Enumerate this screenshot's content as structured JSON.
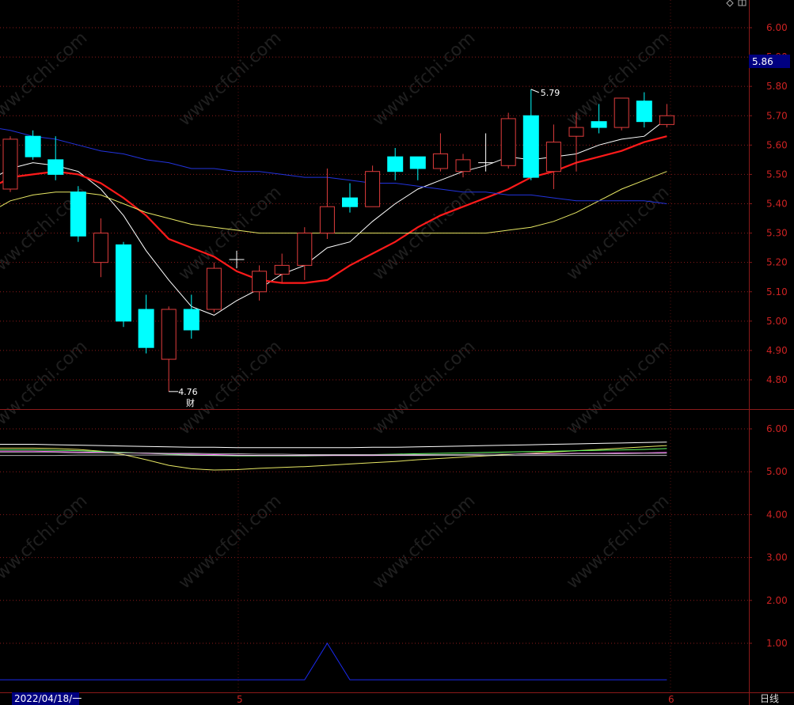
{
  "watermark": "www.cfchi.com",
  "timeframe_label": "日线",
  "date_label": "2022/04/18/一",
  "month_labels": [
    "5",
    "6"
  ],
  "finance_marker": "财",
  "current_price_tag": "5.86",
  "colors": {
    "background": "#000000",
    "frame": "#8b1a1a",
    "grid": "#8b1a1a",
    "axis_text": "#cc2222",
    "up": "#e03c3c",
    "down": "#00ffff",
    "ma5": "#ffffff",
    "ma10": "#ff1a1a",
    "ma20": "#e8e864",
    "ma60": "#2233dd",
    "current_tag_bg": "#000080",
    "volume_line": "#1a2aee"
  },
  "chart_data": [
    {
      "type": "candlestick",
      "panel": "main",
      "y_ticks": [
        "6.00",
        "5.90",
        "5.80",
        "5.70",
        "5.60",
        "5.50",
        "5.40",
        "5.30",
        "5.20",
        "5.10",
        "5.00",
        "4.90",
        "4.80"
      ],
      "ylim": [
        4.72,
        6.03
      ],
      "grid": true,
      "annotations": [
        {
          "text": "5.79",
          "value": 5.79,
          "kind": "high"
        },
        {
          "text": "4.76",
          "value": 4.76,
          "kind": "low"
        }
      ],
      "candles": [
        {
          "open": 5.45,
          "close": 5.62,
          "high": 5.63,
          "low": 5.44
        },
        {
          "open": 5.63,
          "close": 5.56,
          "high": 5.65,
          "low": 5.55
        },
        {
          "open": 5.55,
          "close": 5.5,
          "high": 5.63,
          "low": 5.48
        },
        {
          "open": 5.44,
          "close": 5.29,
          "high": 5.46,
          "low": 5.27
        },
        {
          "open": 5.2,
          "close": 5.3,
          "high": 5.35,
          "low": 5.15
        },
        {
          "open": 5.26,
          "close": 5.0,
          "high": 5.27,
          "low": 4.98
        },
        {
          "open": 5.04,
          "close": 4.91,
          "high": 5.09,
          "low": 4.89
        },
        {
          "open": 4.87,
          "close": 5.04,
          "high": 5.05,
          "low": 4.76
        },
        {
          "open": 5.04,
          "close": 4.97,
          "high": 5.09,
          "low": 4.94
        },
        {
          "open": 5.04,
          "close": 5.18,
          "high": 5.2,
          "low": 5.03
        },
        {
          "open": 5.21,
          "close": 5.21,
          "high": 5.24,
          "low": 5.18
        },
        {
          "open": 5.1,
          "close": 5.17,
          "high": 5.19,
          "low": 5.07
        },
        {
          "open": 5.16,
          "close": 5.19,
          "high": 5.23,
          "low": 5.13
        },
        {
          "open": 5.19,
          "close": 5.3,
          "high": 5.32,
          "low": 5.14
        },
        {
          "open": 5.3,
          "close": 5.39,
          "high": 5.52,
          "low": 5.28
        },
        {
          "open": 5.42,
          "close": 5.39,
          "high": 5.47,
          "low": 5.37
        },
        {
          "open": 5.39,
          "close": 5.51,
          "high": 5.53,
          "low": 5.39
        },
        {
          "open": 5.56,
          "close": 5.51,
          "high": 5.59,
          "low": 5.48
        },
        {
          "open": 5.56,
          "close": 5.52,
          "high": 5.56,
          "low": 5.48
        },
        {
          "open": 5.52,
          "close": 5.57,
          "high": 5.64,
          "low": 5.51
        },
        {
          "open": 5.51,
          "close": 5.55,
          "high": 5.57,
          "low": 5.49
        },
        {
          "open": 5.54,
          "close": 5.54,
          "high": 5.64,
          "low": 5.51
        },
        {
          "open": 5.53,
          "close": 5.69,
          "high": 5.71,
          "low": 5.52
        },
        {
          "open": 5.7,
          "close": 5.49,
          "high": 5.79,
          "low": 5.48
        },
        {
          "open": 5.51,
          "close": 5.61,
          "high": 5.67,
          "low": 5.45
        },
        {
          "open": 5.63,
          "close": 5.66,
          "high": 5.71,
          "low": 5.51
        },
        {
          "open": 5.68,
          "close": 5.66,
          "high": 5.74,
          "low": 5.64
        },
        {
          "open": 5.66,
          "close": 5.76,
          "high": 5.76,
          "low": 5.65
        },
        {
          "open": 5.75,
          "close": 5.68,
          "high": 5.78,
          "low": 5.66
        },
        {
          "open": 5.67,
          "close": 5.7,
          "high": 5.74,
          "low": 5.66
        }
      ],
      "series": [
        {
          "values": [
            5.52,
            5.54,
            5.53,
            5.51,
            5.45,
            5.36,
            5.24,
            5.14,
            5.05,
            5.02,
            5.07,
            5.11,
            5.16,
            5.19,
            5.25,
            5.27,
            5.34,
            5.4,
            5.45,
            5.48,
            5.51,
            5.53,
            5.56,
            5.55,
            5.56,
            5.57,
            5.6,
            5.62,
            5.63,
            5.69
          ]
        },
        {
          "values": [
            5.49,
            5.5,
            5.51,
            5.5,
            5.47,
            5.42,
            5.36,
            5.28,
            5.25,
            5.22,
            5.17,
            5.14,
            5.13,
            5.13,
            5.14,
            5.19,
            5.23,
            5.27,
            5.32,
            5.36,
            5.39,
            5.42,
            5.45,
            5.49,
            5.51,
            5.54,
            5.56,
            5.58,
            5.61,
            5.63
          ]
        },
        {
          "values": [
            5.41,
            5.43,
            5.44,
            5.44,
            5.43,
            5.4,
            5.37,
            5.35,
            5.33,
            5.32,
            5.31,
            5.3,
            5.3,
            5.3,
            5.3,
            5.3,
            5.3,
            5.3,
            5.3,
            5.3,
            5.3,
            5.3,
            5.31,
            5.32,
            5.34,
            5.37,
            5.41,
            5.45,
            5.48,
            5.51
          ]
        },
        {
          "values": [
            5.65,
            5.63,
            5.62,
            5.6,
            5.58,
            5.57,
            5.55,
            5.54,
            5.52,
            5.52,
            5.51,
            5.51,
            5.5,
            5.49,
            5.49,
            5.48,
            5.47,
            5.47,
            5.46,
            5.45,
            5.44,
            5.44,
            5.43,
            5.43,
            5.42,
            5.41,
            5.41,
            5.41,
            5.41,
            5.4
          ]
        }
      ]
    },
    {
      "type": "line",
      "panel": "indicator",
      "y_ticks": [
        "6.00",
        "5.00",
        "4.00",
        "3.00",
        "2.00",
        "1.00"
      ],
      "ylim": [
        0.1,
        6.3
      ],
      "grid": true,
      "series": [
        {
          "values": [
            5.64,
            5.64,
            5.63,
            5.62,
            5.61,
            5.6,
            5.59,
            5.58,
            5.57,
            5.57,
            5.56,
            5.56,
            5.56,
            5.56,
            5.56,
            5.56,
            5.57,
            5.57,
            5.58,
            5.59,
            5.6,
            5.61,
            5.62,
            5.63,
            5.64,
            5.65,
            5.66,
            5.67,
            5.68,
            5.69
          ]
        },
        {
          "values": [
            5.55,
            5.55,
            5.54,
            5.52,
            5.48,
            5.4,
            5.28,
            5.15,
            5.07,
            5.04,
            5.05,
            5.08,
            5.1,
            5.12,
            5.15,
            5.18,
            5.21,
            5.24,
            5.28,
            5.31,
            5.34,
            5.37,
            5.4,
            5.43,
            5.46,
            5.49,
            5.52,
            5.55,
            5.58,
            5.61
          ]
        },
        {
          "values": [
            5.51,
            5.51,
            5.5,
            5.49,
            5.47,
            5.45,
            5.43,
            5.41,
            5.39,
            5.38,
            5.37,
            5.37,
            5.37,
            5.37,
            5.38,
            5.39,
            5.4,
            5.41,
            5.42,
            5.43,
            5.44,
            5.45,
            5.46,
            5.47,
            5.48,
            5.49,
            5.5,
            5.51,
            5.52,
            5.54
          ]
        },
        {
          "values": [
            5.48,
            5.48,
            5.47,
            5.46,
            5.45,
            5.44,
            5.43,
            5.42,
            5.41,
            5.4,
            5.39,
            5.38,
            5.38,
            5.38,
            5.38,
            5.38,
            5.38,
            5.39,
            5.39,
            5.4,
            5.4,
            5.41,
            5.41,
            5.42,
            5.42,
            5.43,
            5.43,
            5.44,
            5.44,
            5.45
          ]
        },
        {
          "values": [
            5.45,
            5.45,
            5.45,
            5.44,
            5.44,
            5.44,
            5.44,
            5.43,
            5.43,
            5.42,
            5.42,
            5.41,
            5.41,
            5.4,
            5.4,
            5.4,
            5.4,
            5.4,
            5.4,
            5.4,
            5.4,
            5.41,
            5.41,
            5.41,
            5.41,
            5.42,
            5.42,
            5.42,
            5.43,
            5.43
          ]
        },
        {
          "values": [
            5.38,
            5.38,
            5.38,
            5.39,
            5.39,
            5.39,
            5.39,
            5.39,
            5.38,
            5.38,
            5.38,
            5.38,
            5.38,
            5.38,
            5.38,
            5.38,
            5.38,
            5.38,
            5.38,
            5.38,
            5.38,
            5.38,
            5.38,
            5.38,
            5.38,
            5.38,
            5.38,
            5.38,
            5.38,
            5.38
          ]
        },
        {
          "values": [
            0.15,
            0.15,
            0.15,
            0.15,
            0.15,
            0.15,
            0.15,
            0.15,
            0.15,
            0.15,
            0.15,
            0.15,
            0.15,
            0.15,
            1.0,
            0.15,
            0.15,
            0.15,
            0.15,
            0.15,
            0.15,
            0.15,
            0.15,
            0.15,
            0.15,
            0.15,
            0.15,
            0.15,
            0.15,
            0.15
          ]
        }
      ]
    }
  ]
}
